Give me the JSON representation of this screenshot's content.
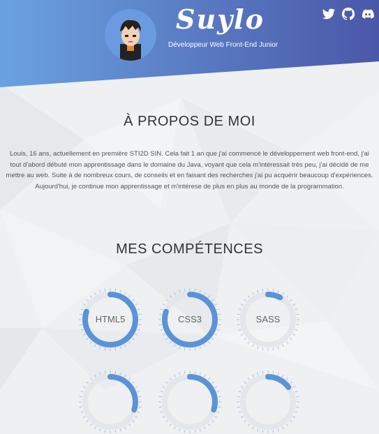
{
  "header": {
    "brand": "Suylo",
    "tagline": "Développeur Web Front-End Junior",
    "gradient": [
      "#6aa2e0",
      "#4a57a8"
    ],
    "social_icons": [
      "twitter-icon",
      "github-icon",
      "discord-icon"
    ]
  },
  "about": {
    "title": "À PROPOS DE MOI",
    "text": "Louis, 16 ans, actuellement en première STI2D SIN. Cela fait 1 an que j'ai commencé le développement web front-end, j'ai tout d'abord débuté mon apprentissage dans le domaine du Java, voyant que cela m'intéressait très peu, j'ai décidé de me mettre au web. Suite à de nombreux cours, de conseils et en faisant des recherches j'ai pu acquérir beaucoup d'expériences. Aujourd'hui, je continue mon apprentissage et m'intérese de plus en plus au monde de la programmation."
  },
  "skills": {
    "title": "MES COMPÉTENCES",
    "accent": "#5b93d9",
    "items": [
      {
        "name": "HTML5",
        "level": 0.8
      },
      {
        "name": "CSS3",
        "level": 0.8
      },
      {
        "name": "SASS",
        "level": 0.08
      }
    ],
    "row2_items": [
      {
        "name": "",
        "level": 0.3
      },
      {
        "name": "",
        "level": 0.3
      },
      {
        "name": "",
        "level": 0.15
      }
    ]
  }
}
